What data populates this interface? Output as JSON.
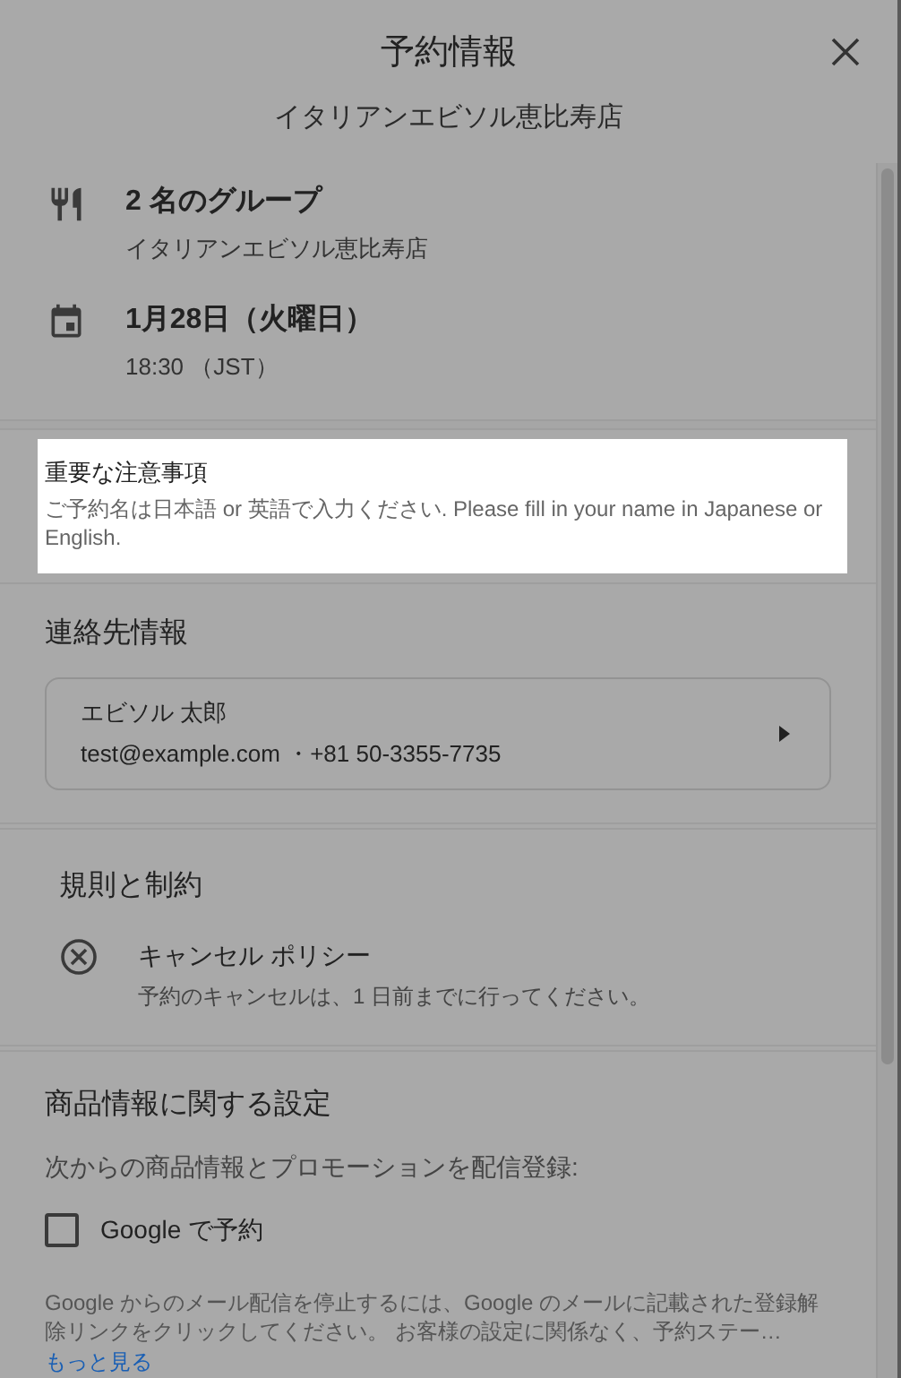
{
  "dialog": {
    "title": "予約情報",
    "subtitle": "イタリアンエビソル恵比寿店"
  },
  "details": [
    {
      "kind": "party",
      "title": "2 名のグループ",
      "subtitle": "イタリアンエビソル恵比寿店"
    },
    {
      "kind": "date",
      "title": "1月28日（火曜日）",
      "subtitle": "18:30 （JST）"
    }
  ],
  "notice": {
    "highlighted": true,
    "title": "重要な注意事項",
    "text": "ご予約名は日本語 or 英語で入力ください. Please fill in your name in Japanese or English."
  },
  "contact": {
    "heading": "連絡先情報",
    "name": "エビソル 太郎",
    "details": "test@example.com ・+81 50-3355-7735"
  },
  "rules": {
    "heading": "規則と制約",
    "items": [
      {
        "title": "キャンセル ポリシー",
        "text": "予約のキャンセルは、1 日前までに行ってください。"
      }
    ]
  },
  "marketing": {
    "heading": "商品情報に関する設定",
    "intro": "次からの商品情報とプロモーションを配信登録:",
    "options": [
      {
        "label": "Google で予約",
        "checked": false
      }
    ],
    "text": "Google からのメール配信を停止するには、Google のメールに記載された登録解除リンクをクリックしてください。 お客様の設定に関係なく、予約ステー…",
    "more": "もっと見る"
  }
}
